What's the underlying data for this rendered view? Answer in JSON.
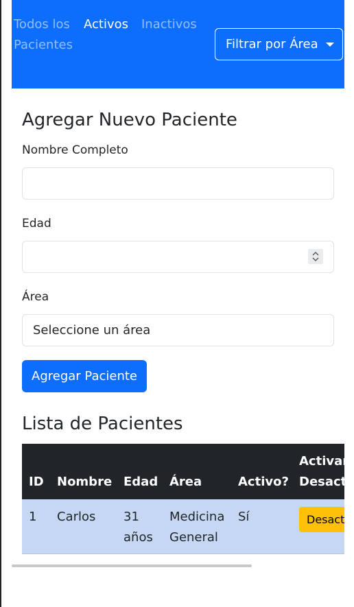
{
  "navbar": {
    "all_patients": "Todos los Pacientes",
    "active": "Activos",
    "inactive": "Inactivos",
    "filter_button": "Filtrar por Área"
  },
  "form": {
    "title": "Agregar Nuevo Paciente",
    "name_label": "Nombre Completo",
    "name_value": "",
    "age_label": "Edad",
    "age_value": "",
    "area_label": "Área",
    "area_selected": "Seleccione un área",
    "submit_label": "Agregar Paciente"
  },
  "patients": {
    "title": "Lista de Pacientes",
    "columns": {
      "id": "ID",
      "name": "Nombre",
      "age": "Edad",
      "area": "Área",
      "active": "Activo?",
      "toggle_line1": "Activar/",
      "toggle_line2": "Desactivar"
    },
    "rows": [
      {
        "id": "1",
        "name": "Carlos",
        "age_num": "31",
        "age_unit": "años",
        "area_line1": "Medicina",
        "area_line2": "General",
        "active": "Sí",
        "toggle_label": "Desactivar"
      }
    ]
  },
  "colors": {
    "primary": "#0d6efd",
    "table_header": "#212529",
    "row_highlight": "#c5d7f2",
    "warning": "#ffc107"
  }
}
